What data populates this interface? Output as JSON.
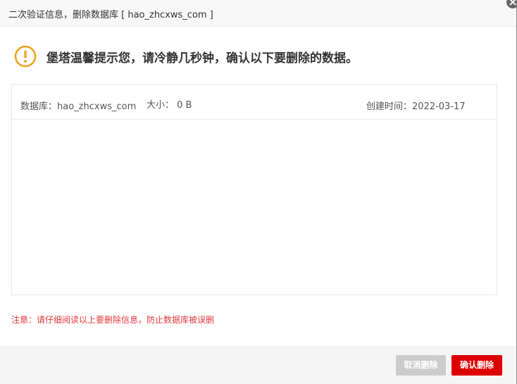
{
  "dialog": {
    "title": "二次验证信息，删除数据库 [ hao_zhcxws_com ]",
    "warning": "堡塔温馨提示您，请冷静几秒钟，确认以下要删除的数据。",
    "database": {
      "name_text": "数据库：hao_zhcxws_com",
      "size_text": "大小： 0 B",
      "created_text": "创建时间：2022-03-17"
    },
    "notice": "注意：请仔细阅读以上要删除信息，防止数据库被误删",
    "buttons": {
      "cancel": "取消删除",
      "confirm": "确认删除",
      "cancel_disabled": true
    }
  },
  "colors": {
    "warning_icon": "#f0a020",
    "notice": "#e4393c",
    "confirm_button": "#dd0000",
    "cancel_button": "#cccccc"
  },
  "icons": {
    "warning": "exclamation-circle-icon",
    "close": "close-icon"
  }
}
